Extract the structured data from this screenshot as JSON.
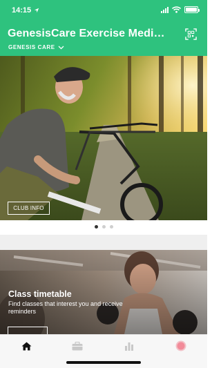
{
  "status_bar": {
    "time": "14:15"
  },
  "header": {
    "title": "GenesisCare Exercise Medi…",
    "organization": "GENESIS CARE",
    "scan_icon": "qr-scan-icon",
    "background_color": "#2ec27e"
  },
  "hero": {
    "button_label": "CLUB INFO",
    "image": "cyclist-photo",
    "carousel": {
      "pages": 3,
      "active": 1
    }
  },
  "card": {
    "title": "Class timetable",
    "description": "Find classes that interest you and receive reminders",
    "image": "boxing-class-photo"
  },
  "tabbar": {
    "items": [
      {
        "icon": "home-icon",
        "active": true
      },
      {
        "icon": "briefcase-icon",
        "active": false
      },
      {
        "icon": "bar-chart-icon",
        "active": false
      },
      {
        "icon": "profile-circle-icon",
        "active": false
      }
    ]
  },
  "colors": {
    "accent": "#2ec27e",
    "tab_active": "#111111",
    "tab_inactive": "#c8c8c8",
    "profile": "#f28b99"
  }
}
